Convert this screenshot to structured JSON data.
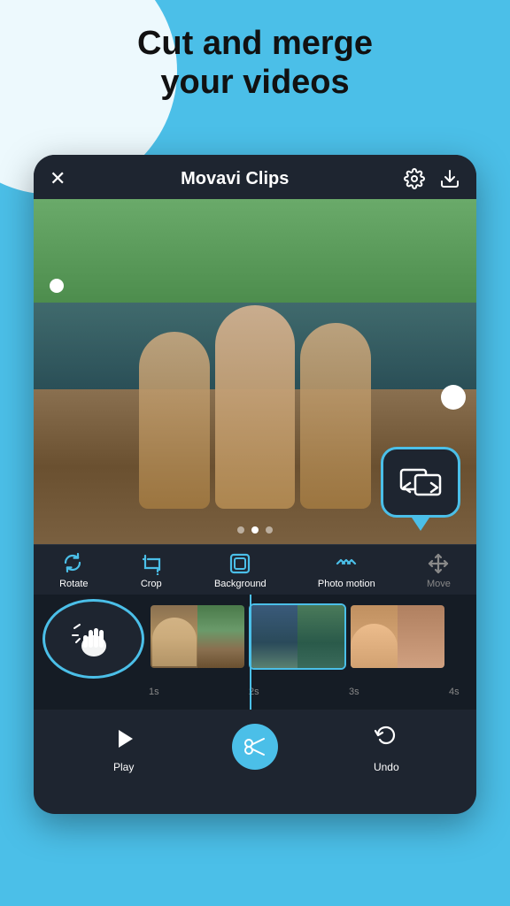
{
  "page": {
    "bg_color": "#4bbfe8"
  },
  "headline": {
    "line1": "Cut and merge",
    "line2": "your videos"
  },
  "app": {
    "title": "Movavi Clips",
    "header": {
      "close_label": "×",
      "settings_label": "⚙",
      "download_label": "⬇"
    },
    "toolbar": {
      "items": [
        {
          "id": "rotate",
          "label": "Rotate",
          "active": true
        },
        {
          "id": "crop",
          "label": "Crop",
          "active": true
        },
        {
          "id": "background",
          "label": "Background",
          "active": true
        },
        {
          "id": "photo_motion",
          "label": "Photo motion",
          "active": true
        },
        {
          "id": "move",
          "label": "Move",
          "active": false
        }
      ]
    },
    "timeline": {
      "timecodes": [
        "1s",
        "2s",
        "3s",
        "4s"
      ]
    },
    "bottom_controls": {
      "play_label": "Play",
      "scissors_label": "",
      "undo_label": "Undo"
    }
  }
}
